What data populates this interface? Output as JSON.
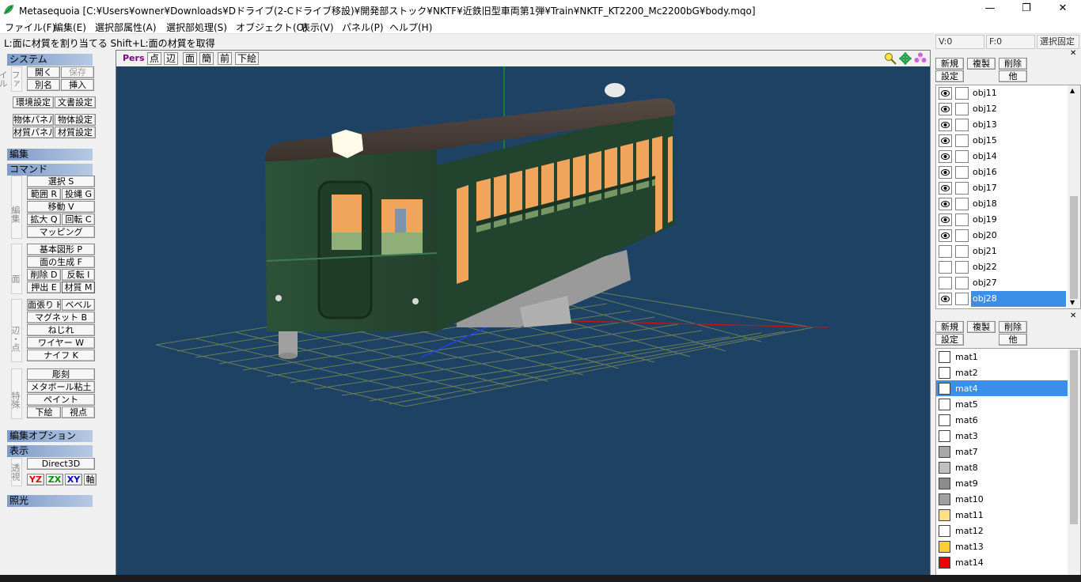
{
  "window": {
    "title": "Metasequoia [C:¥Users¥owner¥Downloads¥Dドライブ(2-Cドライブ移設)¥開発部ストック¥NKTF¥近鉄旧型車両第1弾¥Train¥NKTF_KT2200_Mc2200bG¥body.mqo]",
    "minimize": "—",
    "maximize": "❐",
    "close": "✕"
  },
  "menu": [
    "ファイル(F)",
    "編集(E)",
    "選択部属性(A)",
    "選択部処理(S)",
    "オブジェクト(O)",
    "表示(V)",
    "パネル(P)",
    "ヘルプ(H)"
  ],
  "hint": "L:面に材質を割り当てる  Shift+L:面の材質を取得",
  "status": {
    "vertices": "V:0",
    "faces": "F:0",
    "fixed": "選択固定"
  },
  "left": {
    "system": "システム",
    "file_label": "ファイル",
    "open": "開く",
    "save": "保存",
    "saveas": "別名",
    "insert": "挿入",
    "env": "環境設定",
    "doc": "文書設定",
    "objpanel": "物体パネル",
    "objset": "物体設定",
    "matpanel": "材質パネル",
    "matset": "材質設定",
    "edit": "編集",
    "command": "コマンド",
    "edit_label": "編集",
    "select": "選択 S",
    "range": "範囲 R",
    "lasso": "投縄 G",
    "move": "移動 V",
    "scale": "拡大 Q",
    "rotate": "回転 C",
    "mapping": "マッピング",
    "face_label": "面",
    "prim": "基本図形 P",
    "faceGen": "面の生成 F",
    "delete": "削除 D",
    "invert": "反転 I",
    "extrude": "押出 E",
    "material": "材質 M",
    "edge_label": "辺・点",
    "chamfer": "面張り H",
    "bevel": "ベベル",
    "magnet": "マグネット B",
    "twist": "ねじれ",
    "wire": "ワイヤー W",
    "knife": "ナイフ K",
    "special_label": "特殊",
    "sculpt": "彫刻",
    "metaball": "メタボール粘土",
    "paint": "ペイント",
    "underlay": "下絵",
    "viewpoint": "視点",
    "editopt": "編集オプション",
    "display": "表示",
    "persp_label": "透視",
    "direct3d": "Direct3D",
    "yz": "YZ",
    "zx": "ZX",
    "xy": "XY",
    "axis": "軸",
    "light": "照光"
  },
  "viewport": {
    "pers": "Pers",
    "point": "点",
    "edge": "辺",
    "face": "面",
    "simple": "簡",
    "front": "前",
    "underlay": "下絵"
  },
  "objects": {
    "new": "新規",
    "copy": "複製",
    "delete": "削除",
    "settings": "設定",
    "other": "他",
    "items": [
      {
        "name": "obj11",
        "visible": true
      },
      {
        "name": "obj12",
        "visible": true
      },
      {
        "name": "obj13",
        "visible": true
      },
      {
        "name": "obj15",
        "visible": true
      },
      {
        "name": "obj14",
        "visible": true
      },
      {
        "name": "obj16",
        "visible": true
      },
      {
        "name": "obj17",
        "visible": true
      },
      {
        "name": "obj18",
        "visible": true
      },
      {
        "name": "obj19",
        "visible": true
      },
      {
        "name": "obj20",
        "visible": true
      },
      {
        "name": "obj21",
        "visible": false
      },
      {
        "name": "obj22",
        "visible": false
      },
      {
        "name": "obj27",
        "visible": false
      },
      {
        "name": "obj28",
        "visible": true,
        "selected": true
      }
    ]
  },
  "materials": {
    "new": "新規",
    "copy": "複製",
    "delete": "削除",
    "settings": "設定",
    "other": "他",
    "items": [
      {
        "name": "mat1",
        "color": "#ffffff"
      },
      {
        "name": "mat2",
        "color": "#ffffff"
      },
      {
        "name": "mat4",
        "color": "#ffffff",
        "selected": true
      },
      {
        "name": "mat5",
        "color": "#ffffff"
      },
      {
        "name": "mat6",
        "color": "#ffffff"
      },
      {
        "name": "mat3",
        "color": "#ffffff"
      },
      {
        "name": "mat7",
        "color": "#a8a8a8"
      },
      {
        "name": "mat8",
        "color": "#c0c0c0"
      },
      {
        "name": "mat9",
        "color": "#8c8c8c"
      },
      {
        "name": "mat10",
        "color": "#a0a0a0"
      },
      {
        "name": "mat11",
        "color": "#ffe080"
      },
      {
        "name": "mat12",
        "color": "#ffffff"
      },
      {
        "name": "mat13",
        "color": "#ffcc33"
      },
      {
        "name": "mat14",
        "color": "#ee0000"
      }
    ]
  }
}
